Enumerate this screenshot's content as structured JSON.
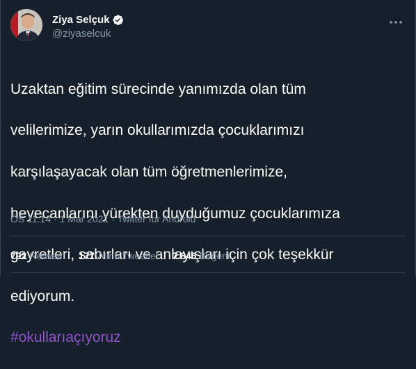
{
  "author": {
    "name": "Ziya Selçuk",
    "handle": "@ziyaselcuk",
    "verified_color": "#1da1f2"
  },
  "tweet": {
    "lines": [
      "Uzaktan eğitim sürecinde yanımızda olan tüm",
      "velilerimize, yarın okullarımızda çocuklarımızı",
      "karşılaşayacak olan tüm öğretmenlerimize,",
      "heyecanlarını yürekten duyduğumuz çocuklarımıza",
      "gayretleri, sabırları ve anlayışları için çok teşekkür",
      "ediyorum."
    ],
    "hashtag": "#okullarıaçıyoruz",
    "hashtag_color": "#9051c9"
  },
  "meta": {
    "text": "ÖS 11:14 · 1 Mar 2021 · Twitter for Android"
  },
  "stats": {
    "retweets": {
      "count": "792",
      "label": "Retweet"
    },
    "quotes": {
      "count": "177",
      "label": "Alıntı Tweetler"
    },
    "likes": {
      "count": "7.846",
      "label": "Beğeni"
    }
  },
  "icons": {
    "verified": "verified-badge-icon",
    "more": "more-options-icon"
  },
  "colors": {
    "background": "#15202b",
    "text": "#ffffff",
    "secondary": "#8899a6",
    "border": "#38444d"
  }
}
